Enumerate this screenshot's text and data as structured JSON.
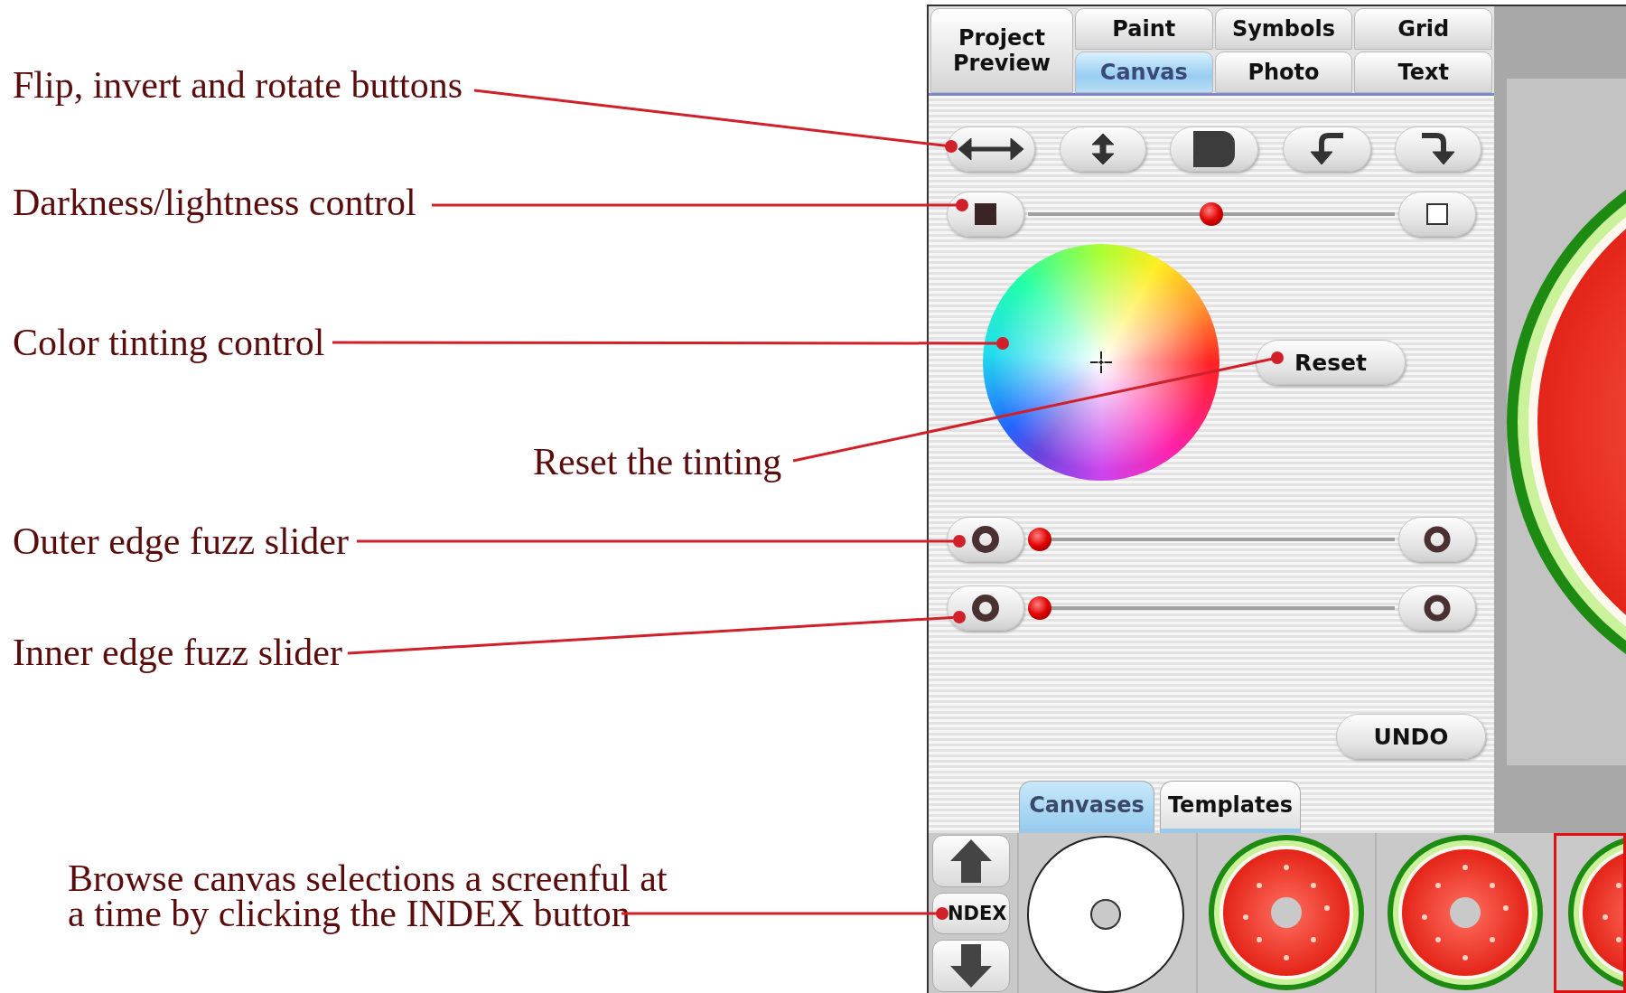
{
  "annotations": [
    {
      "lines": [
        "Flip, invert and rotate buttons"
      ]
    },
    {
      "lines": [
        "Darkness/lightness control"
      ]
    },
    {
      "lines": [
        "Color tinting control"
      ]
    },
    {
      "lines": [
        "Reset the tinting"
      ]
    },
    {
      "lines": [
        "Outer edge fuzz slider"
      ]
    },
    {
      "lines": [
        "Inner edge fuzz slider"
      ]
    },
    {
      "lines": [
        "Browse canvas selections a screenful at",
        "a time by clicking the INDEX button"
      ]
    }
  ],
  "top_tabs": [
    {
      "label": "Project Preview",
      "selected": false
    },
    {
      "label": "Paint",
      "selected": false
    },
    {
      "label": "Symbols",
      "selected": false
    },
    {
      "label": "Grid",
      "selected": false
    },
    {
      "label": "Canvas",
      "selected": true
    },
    {
      "label": "Photo",
      "selected": false
    },
    {
      "label": "Text",
      "selected": false
    }
  ],
  "tool_buttons": [
    {
      "kind": "flip-horizontal"
    },
    {
      "kind": "flip-vertical"
    },
    {
      "kind": "invert"
    },
    {
      "kind": "rotate-left"
    },
    {
      "kind": "rotate-right"
    }
  ],
  "sliders": [
    {
      "kind": "darkness",
      "level": 0.5
    },
    {
      "kind": "outer-fuzz",
      "level": 0
    },
    {
      "kind": "inner-fuzz",
      "level": 0
    }
  ],
  "reset_button": "Reset",
  "undo_button": "UNDO",
  "bottom_tabs": [
    {
      "label": "Canvases",
      "selected": true
    },
    {
      "label": "Templates",
      "selected": false
    }
  ],
  "index_button": "NDEX",
  "thumbnails": [
    {
      "kind": "blank",
      "selected": false
    },
    {
      "kind": "watermelon",
      "selected": false
    },
    {
      "kind": "watermelon",
      "selected": false
    },
    {
      "kind": "watermelon",
      "selected": true
    }
  ]
}
